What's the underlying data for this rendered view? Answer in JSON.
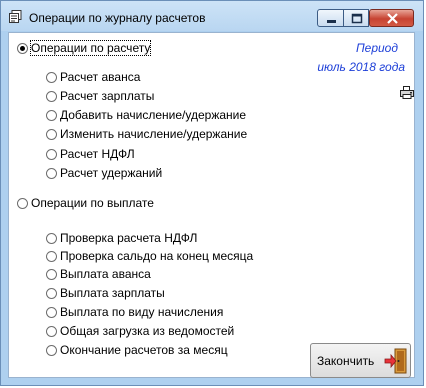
{
  "window": {
    "title": "Операции по журналу расчетов",
    "controls": {
      "minimize_icon": "minimize-icon",
      "maximize_icon": "maximize-icon",
      "close_icon": "close-icon"
    }
  },
  "period": {
    "label": "Период",
    "value": "июль 2018 года",
    "print_icon": "printer-lock-icon"
  },
  "groups": [
    {
      "label": "Операции по расчету",
      "selected": true,
      "options": [
        {
          "label": "Расчет аванса",
          "selected": false
        },
        {
          "label": "Расчет зарплаты",
          "selected": false
        },
        {
          "label": "Добавить начисление/удержание",
          "selected": false
        },
        {
          "label": "Изменить начисление/удержание",
          "selected": false
        },
        {
          "label": "Расчет НДФЛ",
          "selected": false
        },
        {
          "label": "Расчет удержаний",
          "selected": false
        }
      ]
    },
    {
      "label": "Операции по выплате",
      "selected": false,
      "options": [
        {
          "label": "Проверка расчета НДФЛ",
          "selected": false
        },
        {
          "label": "Проверка сальдо на конец месяца",
          "selected": false
        },
        {
          "label": "Выплата аванса",
          "selected": false
        },
        {
          "label": "Выплата зарплаты",
          "selected": false
        },
        {
          "label": "Выплата по виду начисления",
          "selected": false
        },
        {
          "label": "Общая загрузка из ведомостей",
          "selected": false
        },
        {
          "label": "Окончание расчетов за месяц",
          "selected": false
        }
      ]
    }
  ],
  "finish_button": {
    "label": "Закончить",
    "icon": "exit-door-icon"
  },
  "colors": {
    "accent_text": "#1d3fd8",
    "title_bar": "#b9d6f1",
    "close_button": "#c74332"
  }
}
